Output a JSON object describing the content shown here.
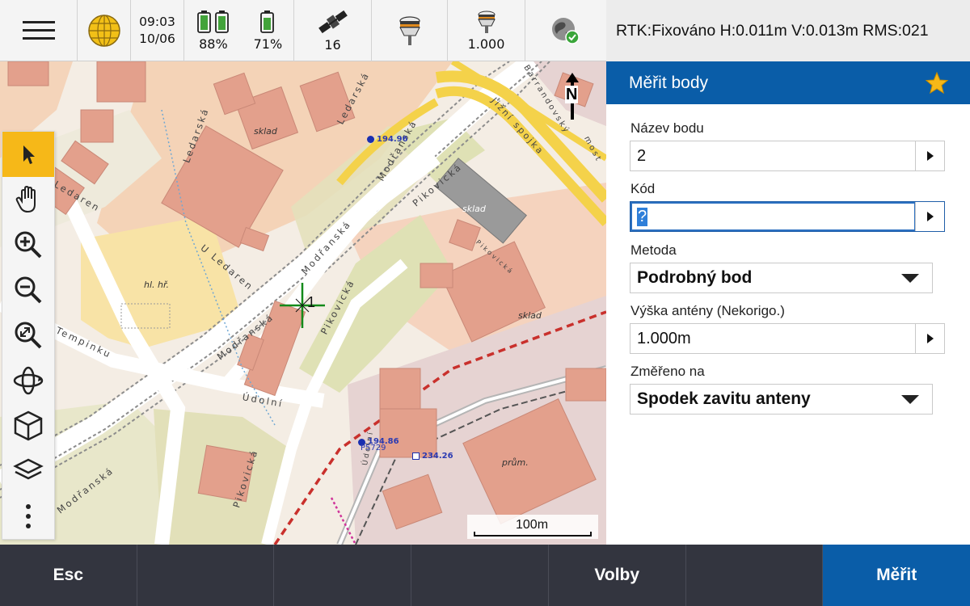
{
  "status_bar": {
    "time": "09:03",
    "date": "10/06",
    "battery_1": "88%",
    "battery_2": "71%",
    "satellites": "16",
    "antenna_height": "1.000",
    "gnss_status": "RTK:Fixováno H:0.011m V:0.013m RMS:021",
    "icons": [
      "menu-icon",
      "globe-icon",
      "battery-icon",
      "satellite-icon",
      "gnss-receiver-icon",
      "antenna-height-icon",
      "connection-status-icon"
    ]
  },
  "map": {
    "labels": {
      "sklad_1": "sklad",
      "sklad_2": "sklad",
      "sklad_3": "sklad",
      "hl_hr": "hl. hř.",
      "prum": "prům."
    },
    "streets": {
      "ledarska_1": "Ledarská",
      "ledarska_2": "Ledarská",
      "ledaren": "Ledaren",
      "u_ledaren": "U Ledaren",
      "modranska_1": "Modřanská",
      "modranska_2": "Modřanská",
      "modranska_3": "Modřanská",
      "modranska_4": "Modřanská",
      "pikovicka_1": "Pikovická",
      "pikovicka_2": "Pikovická",
      "pikovicka_3": "Pikovická",
      "pikovicka_4": "Pikovická",
      "tempinku": "Tempinku",
      "udolni_1": "Údolní",
      "udolni_2": "Údolní",
      "barrandovsky": "Barrandovský",
      "most": "most",
      "jizni_spojka": "Jižní spojka"
    },
    "points": {
      "p1": "194.96",
      "p2": "194.86",
      "p2_name": "P5729",
      "p3": "234.26"
    },
    "north_label": "N",
    "crosshair_label": "1",
    "scale_label": "100m"
  },
  "toolbar": {
    "tools": [
      "select-tool",
      "pan-tool",
      "zoom-in-tool",
      "zoom-out-tool",
      "zoom-extents-tool",
      "orbit-tool",
      "3d-view-tool",
      "layers-tool",
      "more-tool"
    ]
  },
  "panel": {
    "title": "Měřit body",
    "point_name_label": "Název bodu",
    "point_name_value": "2",
    "code_label": "Kód",
    "code_value": "?",
    "method_label": "Metoda",
    "method_value": "Podrobný bod",
    "antenna_height_label": "Výška antény (Nekorigo.)",
    "antenna_height_value": "1.000m",
    "measured_to_label": "Změřeno na",
    "measured_to_value": "Spodek zavitu anteny"
  },
  "bottom_bar": {
    "esc": "Esc",
    "options": "Volby",
    "measure": "Měřit"
  },
  "colors": {
    "accent_blue": "#0a5da8",
    "tool_active": "#f6b818",
    "bottom_bar": "#33353f"
  }
}
